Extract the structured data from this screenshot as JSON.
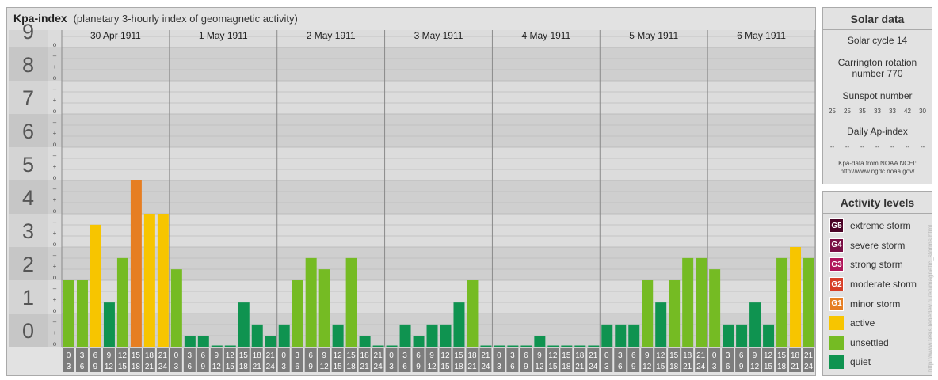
{
  "header": {
    "title": "Kpa-index",
    "subtitle": "(planetary 3-hourly index of geomagnetic activity)"
  },
  "chart_data": {
    "type": "bar",
    "days": [
      "30 Apr 1911",
      "1 May 1911",
      "2 May 1911",
      "3 May 1911",
      "4 May 1911",
      "5 May 1911",
      "6 May 1911"
    ],
    "interval_labels": [
      [
        "0",
        "3"
      ],
      [
        "3",
        "6"
      ],
      [
        "6",
        "9"
      ],
      [
        "9",
        "12"
      ],
      [
        "12",
        "15"
      ],
      [
        "15",
        "18"
      ],
      [
        "18",
        "21"
      ],
      [
        "21",
        "24"
      ]
    ],
    "y_labels": [
      "0",
      "1",
      "2",
      "3",
      "4",
      "5",
      "6",
      "7",
      "8",
      "9"
    ],
    "fraction_labels": [
      "o",
      "+",
      "–"
    ],
    "ylim": [
      0,
      9.33
    ],
    "values": [
      2,
      2,
      3.67,
      1.33,
      2.67,
      5,
      4,
      4,
      2.33,
      0.33,
      0.33,
      0,
      0,
      1.33,
      0.67,
      0.33,
      0.67,
      2,
      2.67,
      2.33,
      0.67,
      2.67,
      0.33,
      0,
      0,
      0.67,
      0.33,
      0.67,
      0.67,
      1.33,
      2,
      0,
      0,
      0,
      0,
      0.33,
      0,
      0,
      0,
      0,
      0.67,
      0.67,
      0.67,
      2,
      1.33,
      2,
      2.67,
      2.67,
      2.33,
      0.67,
      0.67,
      1.33,
      0.67,
      2.67,
      3,
      2.67
    ],
    "level_colors": {
      "quiet": "#0f9350",
      "unsettled": "#75bb23",
      "active": "#f7c500",
      "G1": "#e67e22",
      "G2": "#d73e27",
      "G3": "#b0165a",
      "G4": "#7a0f45",
      "G5": "#4a0326"
    },
    "grid": true
  },
  "solar": {
    "title": "Solar data",
    "cycle": "Solar cycle 14",
    "carrington": "Carrington rotation number 770",
    "sunspot_label": "Sunspot number",
    "sunspots": [
      "25",
      "25",
      "35",
      "33",
      "33",
      "42",
      "30"
    ],
    "ap_label": "Daily Ap-index",
    "ap": [
      "--",
      "--",
      "--",
      "--",
      "--",
      "--",
      "--"
    ],
    "credit1": "Kpa-data from NOAA NCEI:",
    "credit2": "http://www.ngdc.noaa.gov/"
  },
  "activity": {
    "title": "Activity levels",
    "levels": [
      {
        "code": "G5",
        "label": "extreme storm",
        "color": "#4a0326"
      },
      {
        "code": "G4",
        "label": "severe storm",
        "color": "#7a0f45"
      },
      {
        "code": "G3",
        "label": "strong storm",
        "color": "#b0165a"
      },
      {
        "code": "G2",
        "label": "moderate storm",
        "color": "#d73e27"
      },
      {
        "code": "G1",
        "label": "minor storm",
        "color": "#e67e22"
      },
      {
        "code": "",
        "label": "active",
        "color": "#f7c500"
      },
      {
        "code": "",
        "label": "unsettled",
        "color": "#75bb23"
      },
      {
        "code": "",
        "label": "quiet",
        "color": "#0f9350"
      }
    ]
  },
  "watermark": "http://www.tesis.lebedev.ru/en/magnetic_storms.html"
}
